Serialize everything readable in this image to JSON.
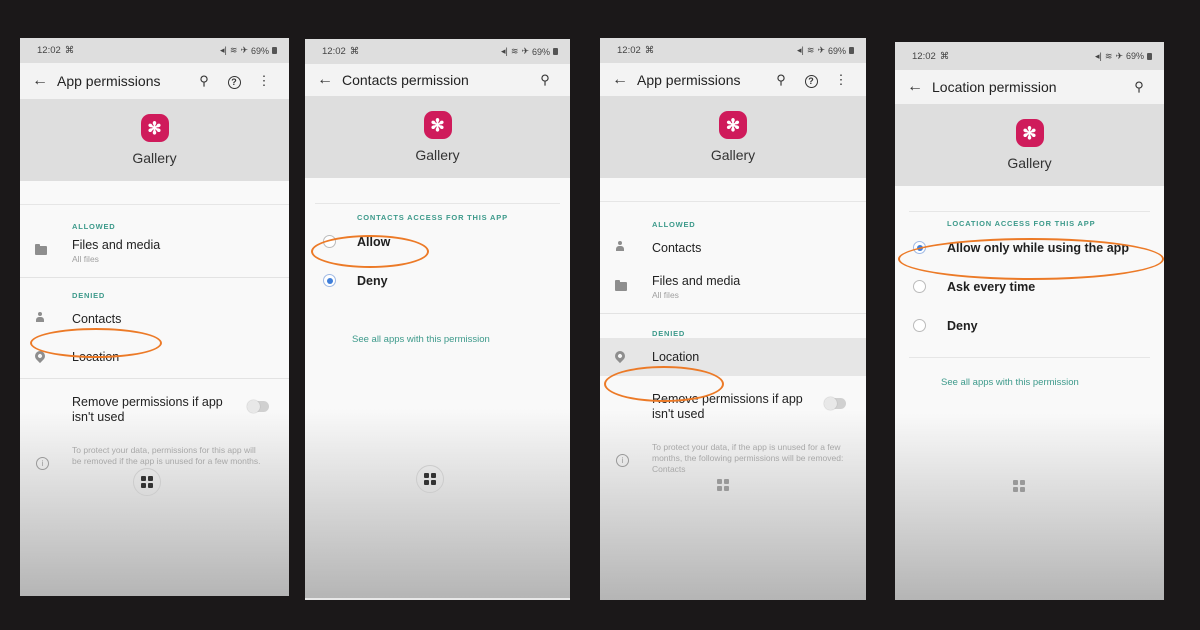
{
  "status_bar": {
    "time": "12:02",
    "battery": "69%"
  },
  "app": {
    "name": "Gallery",
    "icon": "flower-icon",
    "icon_color": "#cf1b5b"
  },
  "accent_color": "#3d9a8b",
  "highlight_color": "#ec7a27",
  "screens": [
    {
      "title": "App permissions",
      "actions": [
        "search-icon",
        "help-icon",
        "more-icon"
      ],
      "allowed_label": "ALLOWED",
      "allowed": [
        {
          "label": "Files and media",
          "sub": "All files",
          "icon": "folder-icon"
        }
      ],
      "denied_label": "DENIED",
      "denied": [
        {
          "label": "Contacts",
          "icon": "person-icon",
          "highlighted": true
        },
        {
          "label": "Location",
          "icon": "location-icon"
        }
      ],
      "toggle_label": "Remove permissions if app isn't used",
      "toggle_on": false,
      "info_text": "To protect your data, permissions for this app will be removed if the app is unused for a few months."
    },
    {
      "title": "Contacts permission",
      "actions": [
        "search-icon"
      ],
      "section_label": "CONTACTS ACCESS FOR THIS APP",
      "options": [
        {
          "label": "Allow",
          "checked": false,
          "highlighted": true
        },
        {
          "label": "Deny",
          "checked": true
        }
      ],
      "link": "See all apps with this permission"
    },
    {
      "title": "App permissions",
      "actions": [
        "search-icon",
        "help-icon",
        "more-icon"
      ],
      "allowed_label": "ALLOWED",
      "allowed": [
        {
          "label": "Contacts",
          "icon": "person-icon"
        },
        {
          "label": "Files and media",
          "sub": "All files",
          "icon": "folder-icon"
        }
      ],
      "denied_label": "DENIED",
      "denied": [
        {
          "label": "Location",
          "icon": "location-icon",
          "highlighted": true
        }
      ],
      "toggle_label": "Remove permissions if app isn't used",
      "toggle_on": false,
      "info_text": "To protect your data, if the app is unused for a few months, the following permissions will be removed: Contacts"
    },
    {
      "title": "Location permission",
      "actions": [
        "search-icon"
      ],
      "section_label": "LOCATION ACCESS FOR THIS APP",
      "options": [
        {
          "label": "Allow only while using the app",
          "checked": true,
          "highlighted": true
        },
        {
          "label": "Ask every time",
          "checked": false
        },
        {
          "label": "Deny",
          "checked": false
        }
      ],
      "link": "See all apps with this permission"
    }
  ]
}
